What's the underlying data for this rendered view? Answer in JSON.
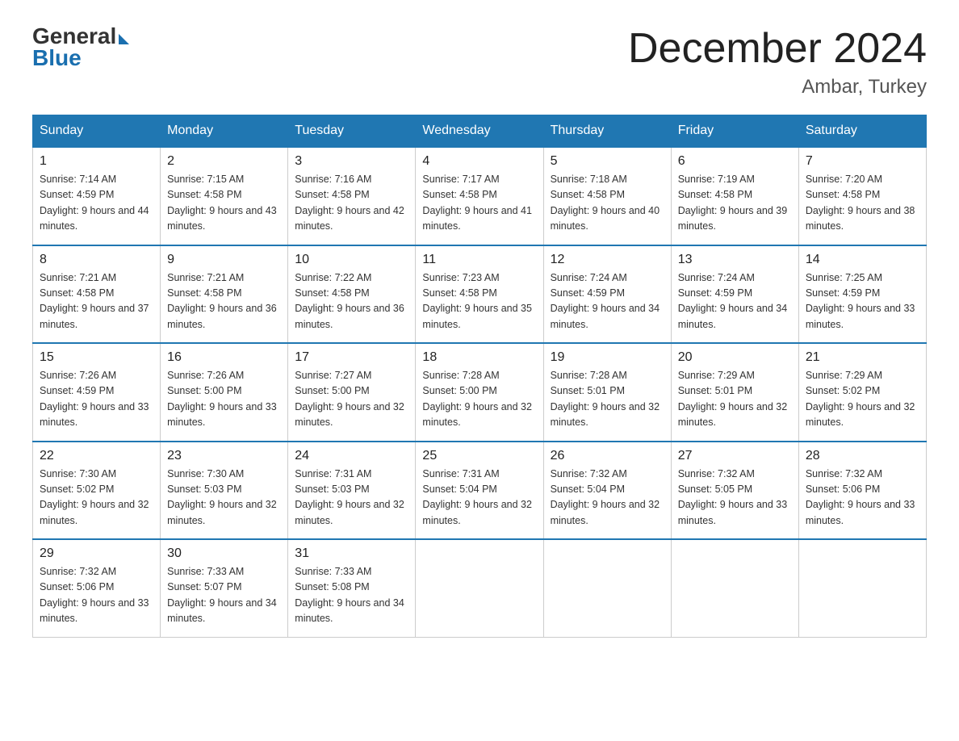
{
  "header": {
    "logo_general": "General",
    "logo_blue": "Blue",
    "title": "December 2024",
    "subtitle": "Ambar, Turkey"
  },
  "days_of_week": [
    "Sunday",
    "Monday",
    "Tuesday",
    "Wednesday",
    "Thursday",
    "Friday",
    "Saturday"
  ],
  "weeks": [
    [
      {
        "day": "1",
        "sunrise": "7:14 AM",
        "sunset": "4:59 PM",
        "daylight": "9 hours and 44 minutes."
      },
      {
        "day": "2",
        "sunrise": "7:15 AM",
        "sunset": "4:58 PM",
        "daylight": "9 hours and 43 minutes."
      },
      {
        "day": "3",
        "sunrise": "7:16 AM",
        "sunset": "4:58 PM",
        "daylight": "9 hours and 42 minutes."
      },
      {
        "day": "4",
        "sunrise": "7:17 AM",
        "sunset": "4:58 PM",
        "daylight": "9 hours and 41 minutes."
      },
      {
        "day": "5",
        "sunrise": "7:18 AM",
        "sunset": "4:58 PM",
        "daylight": "9 hours and 40 minutes."
      },
      {
        "day": "6",
        "sunrise": "7:19 AM",
        "sunset": "4:58 PM",
        "daylight": "9 hours and 39 minutes."
      },
      {
        "day": "7",
        "sunrise": "7:20 AM",
        "sunset": "4:58 PM",
        "daylight": "9 hours and 38 minutes."
      }
    ],
    [
      {
        "day": "8",
        "sunrise": "7:21 AM",
        "sunset": "4:58 PM",
        "daylight": "9 hours and 37 minutes."
      },
      {
        "day": "9",
        "sunrise": "7:21 AM",
        "sunset": "4:58 PM",
        "daylight": "9 hours and 36 minutes."
      },
      {
        "day": "10",
        "sunrise": "7:22 AM",
        "sunset": "4:58 PM",
        "daylight": "9 hours and 36 minutes."
      },
      {
        "day": "11",
        "sunrise": "7:23 AM",
        "sunset": "4:58 PM",
        "daylight": "9 hours and 35 minutes."
      },
      {
        "day": "12",
        "sunrise": "7:24 AM",
        "sunset": "4:59 PM",
        "daylight": "9 hours and 34 minutes."
      },
      {
        "day": "13",
        "sunrise": "7:24 AM",
        "sunset": "4:59 PM",
        "daylight": "9 hours and 34 minutes."
      },
      {
        "day": "14",
        "sunrise": "7:25 AM",
        "sunset": "4:59 PM",
        "daylight": "9 hours and 33 minutes."
      }
    ],
    [
      {
        "day": "15",
        "sunrise": "7:26 AM",
        "sunset": "4:59 PM",
        "daylight": "9 hours and 33 minutes."
      },
      {
        "day": "16",
        "sunrise": "7:26 AM",
        "sunset": "5:00 PM",
        "daylight": "9 hours and 33 minutes."
      },
      {
        "day": "17",
        "sunrise": "7:27 AM",
        "sunset": "5:00 PM",
        "daylight": "9 hours and 32 minutes."
      },
      {
        "day": "18",
        "sunrise": "7:28 AM",
        "sunset": "5:00 PM",
        "daylight": "9 hours and 32 minutes."
      },
      {
        "day": "19",
        "sunrise": "7:28 AM",
        "sunset": "5:01 PM",
        "daylight": "9 hours and 32 minutes."
      },
      {
        "day": "20",
        "sunrise": "7:29 AM",
        "sunset": "5:01 PM",
        "daylight": "9 hours and 32 minutes."
      },
      {
        "day": "21",
        "sunrise": "7:29 AM",
        "sunset": "5:02 PM",
        "daylight": "9 hours and 32 minutes."
      }
    ],
    [
      {
        "day": "22",
        "sunrise": "7:30 AM",
        "sunset": "5:02 PM",
        "daylight": "9 hours and 32 minutes."
      },
      {
        "day": "23",
        "sunrise": "7:30 AM",
        "sunset": "5:03 PM",
        "daylight": "9 hours and 32 minutes."
      },
      {
        "day": "24",
        "sunrise": "7:31 AM",
        "sunset": "5:03 PM",
        "daylight": "9 hours and 32 minutes."
      },
      {
        "day": "25",
        "sunrise": "7:31 AM",
        "sunset": "5:04 PM",
        "daylight": "9 hours and 32 minutes."
      },
      {
        "day": "26",
        "sunrise": "7:32 AM",
        "sunset": "5:04 PM",
        "daylight": "9 hours and 32 minutes."
      },
      {
        "day": "27",
        "sunrise": "7:32 AM",
        "sunset": "5:05 PM",
        "daylight": "9 hours and 33 minutes."
      },
      {
        "day": "28",
        "sunrise": "7:32 AM",
        "sunset": "5:06 PM",
        "daylight": "9 hours and 33 minutes."
      }
    ],
    [
      {
        "day": "29",
        "sunrise": "7:32 AM",
        "sunset": "5:06 PM",
        "daylight": "9 hours and 33 minutes."
      },
      {
        "day": "30",
        "sunrise": "7:33 AM",
        "sunset": "5:07 PM",
        "daylight": "9 hours and 34 minutes."
      },
      {
        "day": "31",
        "sunrise": "7:33 AM",
        "sunset": "5:08 PM",
        "daylight": "9 hours and 34 minutes."
      },
      null,
      null,
      null,
      null
    ]
  ]
}
